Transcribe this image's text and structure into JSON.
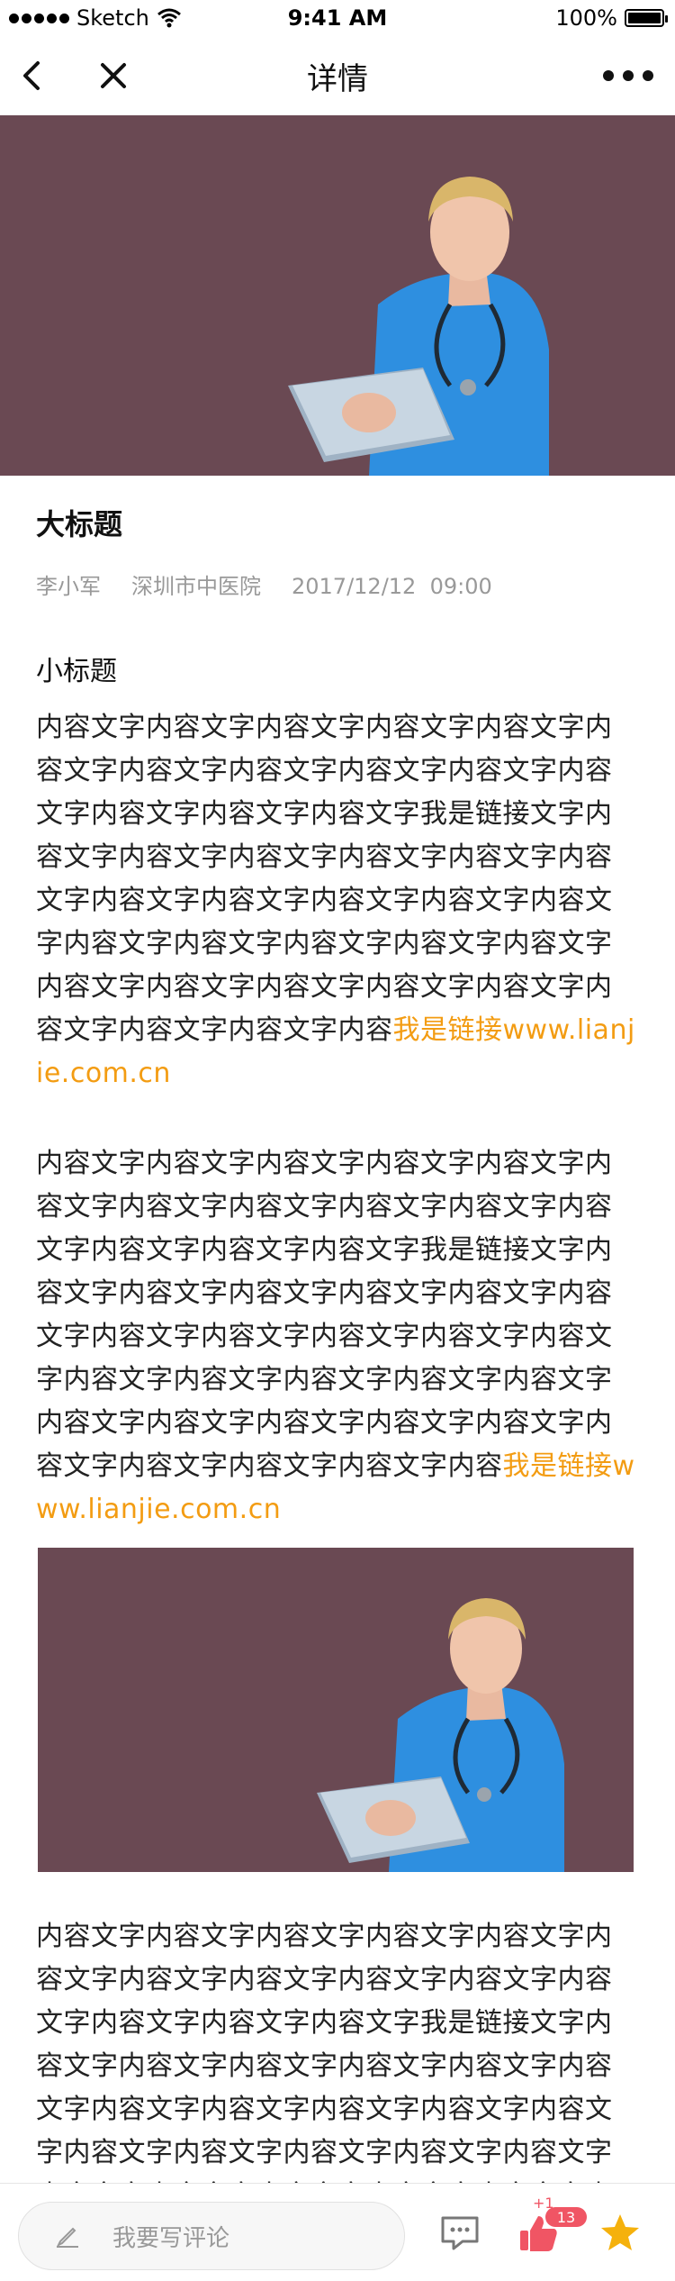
{
  "status_bar": {
    "carrier": "Sketch",
    "time": "9:41 AM",
    "battery": "100%"
  },
  "nav": {
    "title": "详情"
  },
  "article": {
    "title": "大标题",
    "author": "李小军",
    "hospital": "深圳市中医院",
    "date": "2017/12/12",
    "time": "09:00",
    "subtitle": "小标题",
    "paragraph1_text": "内容文字内容文字内容文字内容文字内容文字内容文字内容文字内容文字内容文字内容文字内容文字内容文字内容文字内容文字我是链接文字内容文字内容文字内容文字内容文字内容文字内容文字内容文字内容文字内容文字内容文字内容文字内容文字内容文字内容文字内容文字内容文字内容文字内容文字内容文字内容文字内容文字内容文字内容文字内容文字内容",
    "paragraph1_link": "我是链接www.lianjie.com.cn",
    "paragraph2_text": "内容文字内容文字内容文字内容文字内容文字内容文字内容文字内容文字内容文字内容文字内容文字内容文字内容文字内容文字我是链接文字内容文字内容文字内容文字内容文字内容文字内容文字内容文字内容文字内容文字内容文字内容文字内容文字内容文字内容文字内容文字内容文字内容文字内容文字内容文字内容文字内容文字内容文字内容文字内容文字内容文字内容",
    "paragraph2_link": "我是链接www.lianjie.com.cn",
    "paragraph3_text": "内容文字内容文字内容文字内容文字内容文字内容文字内容文字内容文字内容文字内容文字内容文字内容文字内容文字内容文字我是链接文字内容文字内容文字内容文字内容文字内容文字内容文字内容文字内容文字内容文字内容文字内容文字内容文字内容文字内容文字内容文字内容文字内容文字内容文字内容文字内容文字内容文字内容文字内容"
  },
  "bottom_bar": {
    "comment_placeholder": "我要写评论",
    "like_increment": "+1",
    "like_count": "13"
  },
  "colors": {
    "link": "#f39c12",
    "hero_bg": "#6a4953",
    "badge": "#f05564",
    "star": "#f5b10c"
  }
}
